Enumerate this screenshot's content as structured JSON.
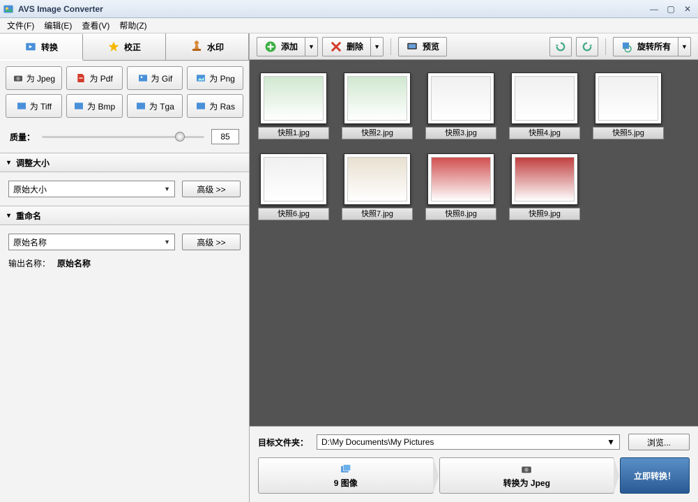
{
  "window": {
    "title": "AVS Image Converter"
  },
  "menu": {
    "file": "文件(F)",
    "edit": "编辑(E)",
    "view": "查看(V)",
    "help": "帮助(Z)"
  },
  "tabs": {
    "convert": "转换",
    "correct": "校正",
    "watermark": "水印"
  },
  "formats": [
    {
      "label": "为 Jpeg"
    },
    {
      "label": "为 Pdf"
    },
    {
      "label": "为 Gif"
    },
    {
      "label": "为 Png"
    },
    {
      "label": "为 Tiff"
    },
    {
      "label": "为 Bmp"
    },
    {
      "label": "为 Tga"
    },
    {
      "label": "为 Ras"
    }
  ],
  "quality": {
    "label": "质量：",
    "value": "85"
  },
  "resize": {
    "title": "调整大小",
    "value": "原始大小",
    "adv": "高级 >>"
  },
  "rename": {
    "title": "重命名",
    "value": "原始名称",
    "adv": "高级 >>",
    "out_label": "输出名称：",
    "out_value": "原始名称"
  },
  "toolbar": {
    "add": "添加",
    "delete": "删除",
    "preview": "预览",
    "rotate_all": "旋转所有"
  },
  "thumbs": [
    {
      "name": "快照1.jpg"
    },
    {
      "name": "快照2.jpg"
    },
    {
      "name": "快照3.jpg"
    },
    {
      "name": "快照4.jpg"
    },
    {
      "name": "快照5.jpg"
    },
    {
      "name": "快照6.jpg"
    },
    {
      "name": "快照7.jpg"
    },
    {
      "name": "快照8.jpg"
    },
    {
      "name": "快照9.jpg"
    }
  ],
  "bottom": {
    "dest_label": "目标文件夹：",
    "dest_path": "D:\\My Documents\\My Pictures",
    "browse": "浏览...",
    "images_count": "9 图像",
    "convert_as": "转换为 Jpeg",
    "go": "立即转换！"
  }
}
